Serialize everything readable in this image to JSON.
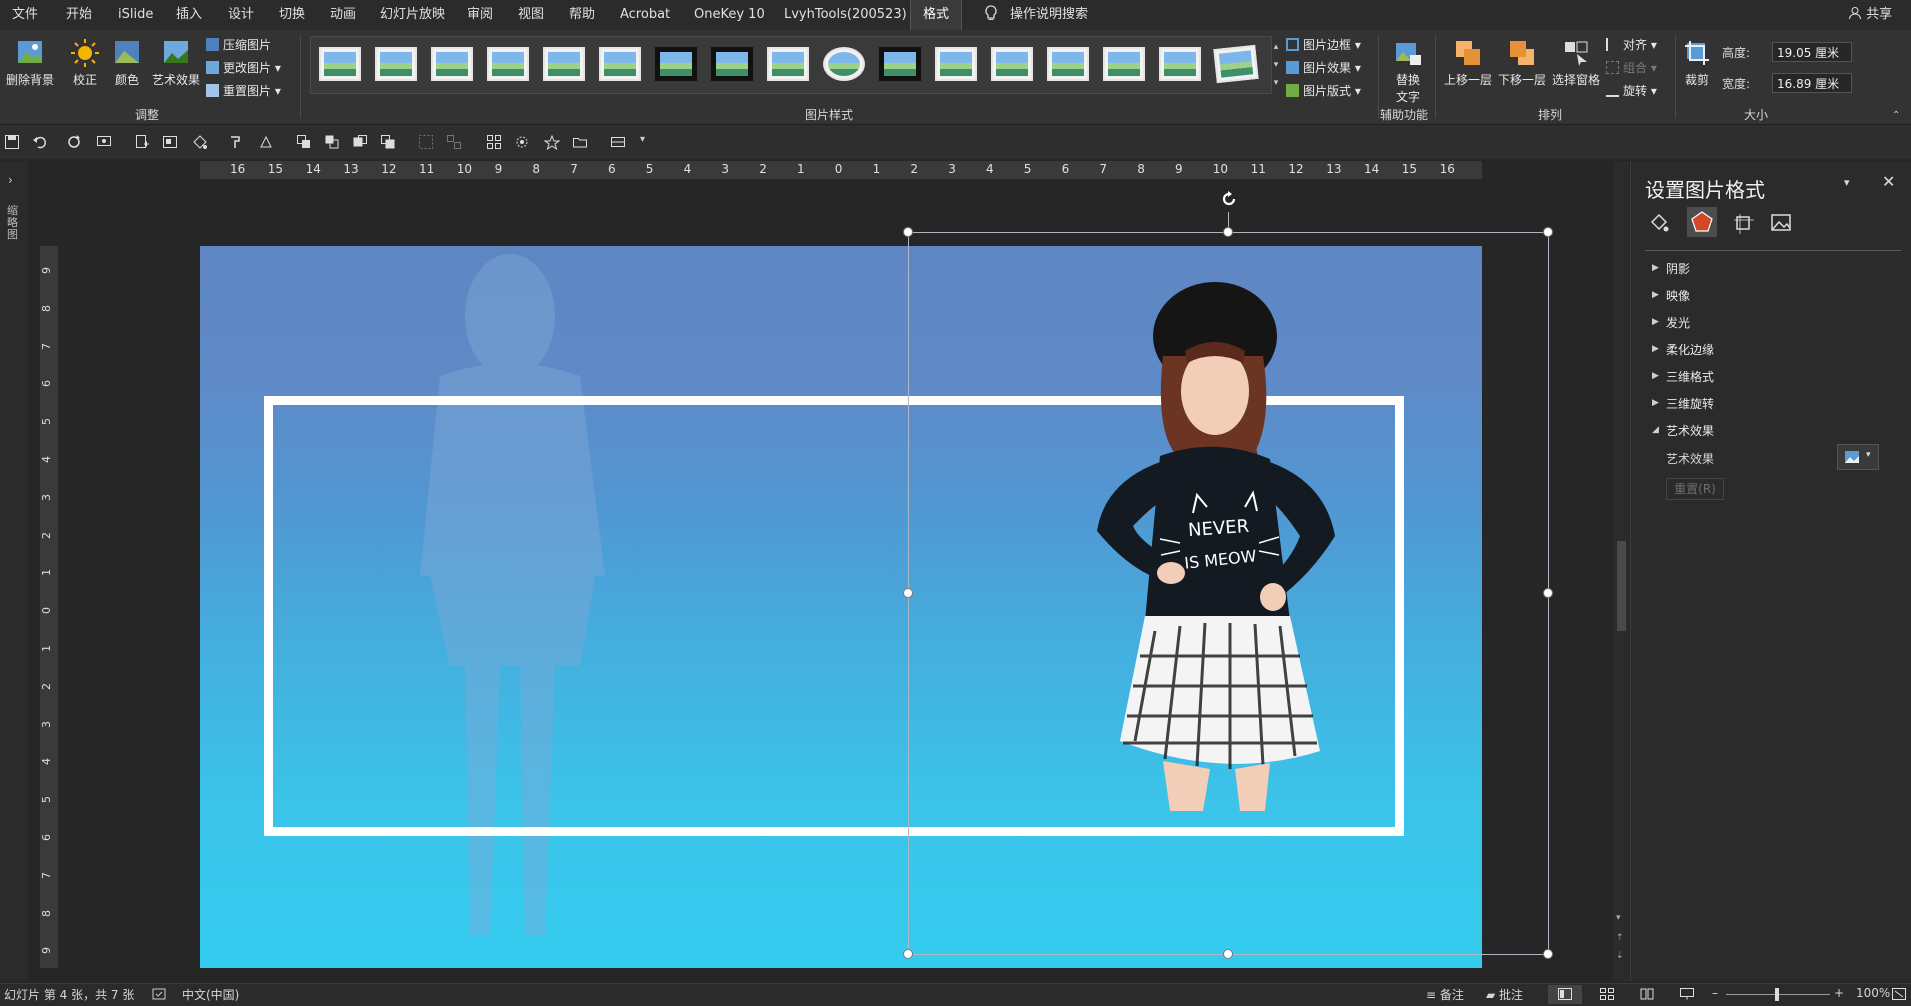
{
  "menu": {
    "file": "文件",
    "home": "开始",
    "islide": "iSlide",
    "insert": "插入",
    "design": "设计",
    "transitions": "切换",
    "animations": "动画",
    "slideshow": "幻灯片放映",
    "review": "审阅",
    "view": "视图",
    "help": "帮助",
    "acrobat": "Acrobat",
    "onekey": "OneKey 10",
    "lvyh": "LvyhTools(200523)",
    "format": "格式",
    "search": "操作说明搜索",
    "share": "共享"
  },
  "ribbon": {
    "remove_bg": "删除背景",
    "corrections": "校正",
    "color": "颜色",
    "artistic": "艺术效果",
    "compress": "压缩图片",
    "change": "更改图片",
    "reset": "重置图片",
    "group_adjust": "调整",
    "group_styles": "图片样式",
    "border": "图片边框",
    "effects": "图片效果",
    "layout": "图片版式",
    "alt_text_1": "替换",
    "alt_text_2": "文字",
    "group_access": "辅助功能",
    "forward": "上移一层",
    "backward": "下移一层",
    "selection_pane": "选择窗格",
    "align": "对齐",
    "grouping": "组合",
    "rotate": "旋转",
    "group_arrange": "排列",
    "crop": "裁剪",
    "height_label": "高度:",
    "height_value": "19.05 厘米",
    "width_label": "宽度:",
    "width_value": "16.89 厘米",
    "group_size": "大小"
  },
  "ruler": {
    "h_ticks": [
      "16",
      "15",
      "14",
      "13",
      "12",
      "11",
      "10",
      "9",
      "8",
      "7",
      "6",
      "5",
      "4",
      "3",
      "2",
      "1",
      "0",
      "1",
      "2",
      "3",
      "4",
      "5",
      "6",
      "7",
      "8",
      "9",
      "10",
      "11",
      "12",
      "13",
      "14",
      "15",
      "16"
    ],
    "v_ticks": [
      "9",
      "8",
      "7",
      "6",
      "5",
      "4",
      "3",
      "2",
      "1",
      "0",
      "1",
      "2",
      "3",
      "4",
      "5",
      "6",
      "7",
      "8",
      "9"
    ]
  },
  "left_strip": {
    "label": "缩略图"
  },
  "slide": {
    "headline": "NEVER",
    "subline": "IS MEOW"
  },
  "pane": {
    "title": "设置图片格式",
    "sections": [
      "阴影",
      "映像",
      "发光",
      "柔化边缘",
      "三维格式",
      "三维旋转",
      "艺术效果"
    ],
    "artistic_label": "艺术效果",
    "reset_button": "重置(R)"
  },
  "status": {
    "slide_info": "幻灯片 第 4 张，共 7 张",
    "language": "中文(中国)",
    "notes": "备注",
    "comments": "批注",
    "zoom": "100%"
  },
  "colors": {
    "accent": "#d24726",
    "frame": "#ffffff",
    "slide_top": "#5e86c2",
    "slide_bottom": "#33ccef"
  }
}
